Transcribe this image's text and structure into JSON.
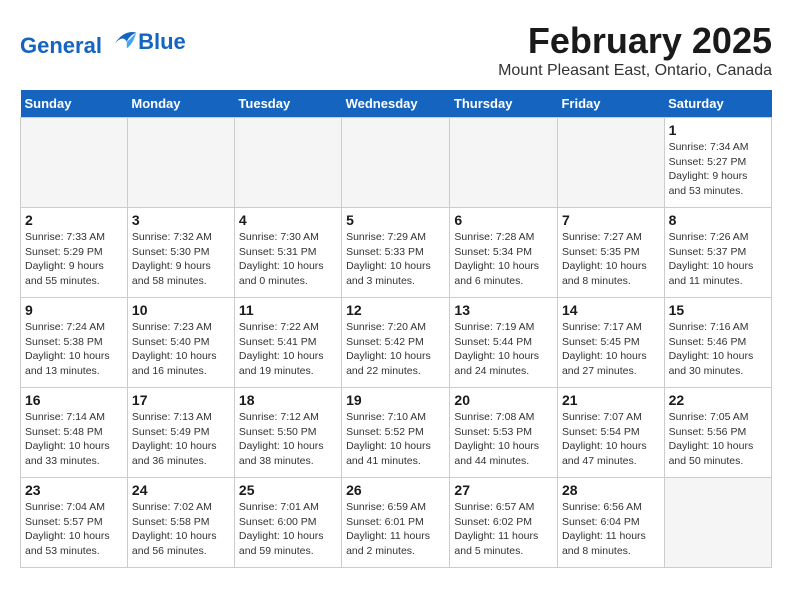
{
  "logo": {
    "line1": "General",
    "line2": "Blue"
  },
  "title": "February 2025",
  "subtitle": "Mount Pleasant East, Ontario, Canada",
  "days_of_week": [
    "Sunday",
    "Monday",
    "Tuesday",
    "Wednesday",
    "Thursday",
    "Friday",
    "Saturday"
  ],
  "weeks": [
    [
      {
        "day": "",
        "info": ""
      },
      {
        "day": "",
        "info": ""
      },
      {
        "day": "",
        "info": ""
      },
      {
        "day": "",
        "info": ""
      },
      {
        "day": "",
        "info": ""
      },
      {
        "day": "",
        "info": ""
      },
      {
        "day": "1",
        "info": "Sunrise: 7:34 AM\nSunset: 5:27 PM\nDaylight: 9 hours and 53 minutes."
      }
    ],
    [
      {
        "day": "2",
        "info": "Sunrise: 7:33 AM\nSunset: 5:29 PM\nDaylight: 9 hours and 55 minutes."
      },
      {
        "day": "3",
        "info": "Sunrise: 7:32 AM\nSunset: 5:30 PM\nDaylight: 9 hours and 58 minutes."
      },
      {
        "day": "4",
        "info": "Sunrise: 7:30 AM\nSunset: 5:31 PM\nDaylight: 10 hours and 0 minutes."
      },
      {
        "day": "5",
        "info": "Sunrise: 7:29 AM\nSunset: 5:33 PM\nDaylight: 10 hours and 3 minutes."
      },
      {
        "day": "6",
        "info": "Sunrise: 7:28 AM\nSunset: 5:34 PM\nDaylight: 10 hours and 6 minutes."
      },
      {
        "day": "7",
        "info": "Sunrise: 7:27 AM\nSunset: 5:35 PM\nDaylight: 10 hours and 8 minutes."
      },
      {
        "day": "8",
        "info": "Sunrise: 7:26 AM\nSunset: 5:37 PM\nDaylight: 10 hours and 11 minutes."
      }
    ],
    [
      {
        "day": "9",
        "info": "Sunrise: 7:24 AM\nSunset: 5:38 PM\nDaylight: 10 hours and 13 minutes."
      },
      {
        "day": "10",
        "info": "Sunrise: 7:23 AM\nSunset: 5:40 PM\nDaylight: 10 hours and 16 minutes."
      },
      {
        "day": "11",
        "info": "Sunrise: 7:22 AM\nSunset: 5:41 PM\nDaylight: 10 hours and 19 minutes."
      },
      {
        "day": "12",
        "info": "Sunrise: 7:20 AM\nSunset: 5:42 PM\nDaylight: 10 hours and 22 minutes."
      },
      {
        "day": "13",
        "info": "Sunrise: 7:19 AM\nSunset: 5:44 PM\nDaylight: 10 hours and 24 minutes."
      },
      {
        "day": "14",
        "info": "Sunrise: 7:17 AM\nSunset: 5:45 PM\nDaylight: 10 hours and 27 minutes."
      },
      {
        "day": "15",
        "info": "Sunrise: 7:16 AM\nSunset: 5:46 PM\nDaylight: 10 hours and 30 minutes."
      }
    ],
    [
      {
        "day": "16",
        "info": "Sunrise: 7:14 AM\nSunset: 5:48 PM\nDaylight: 10 hours and 33 minutes."
      },
      {
        "day": "17",
        "info": "Sunrise: 7:13 AM\nSunset: 5:49 PM\nDaylight: 10 hours and 36 minutes."
      },
      {
        "day": "18",
        "info": "Sunrise: 7:12 AM\nSunset: 5:50 PM\nDaylight: 10 hours and 38 minutes."
      },
      {
        "day": "19",
        "info": "Sunrise: 7:10 AM\nSunset: 5:52 PM\nDaylight: 10 hours and 41 minutes."
      },
      {
        "day": "20",
        "info": "Sunrise: 7:08 AM\nSunset: 5:53 PM\nDaylight: 10 hours and 44 minutes."
      },
      {
        "day": "21",
        "info": "Sunrise: 7:07 AM\nSunset: 5:54 PM\nDaylight: 10 hours and 47 minutes."
      },
      {
        "day": "22",
        "info": "Sunrise: 7:05 AM\nSunset: 5:56 PM\nDaylight: 10 hours and 50 minutes."
      }
    ],
    [
      {
        "day": "23",
        "info": "Sunrise: 7:04 AM\nSunset: 5:57 PM\nDaylight: 10 hours and 53 minutes."
      },
      {
        "day": "24",
        "info": "Sunrise: 7:02 AM\nSunset: 5:58 PM\nDaylight: 10 hours and 56 minutes."
      },
      {
        "day": "25",
        "info": "Sunrise: 7:01 AM\nSunset: 6:00 PM\nDaylight: 10 hours and 59 minutes."
      },
      {
        "day": "26",
        "info": "Sunrise: 6:59 AM\nSunset: 6:01 PM\nDaylight: 11 hours and 2 minutes."
      },
      {
        "day": "27",
        "info": "Sunrise: 6:57 AM\nSunset: 6:02 PM\nDaylight: 11 hours and 5 minutes."
      },
      {
        "day": "28",
        "info": "Sunrise: 6:56 AM\nSunset: 6:04 PM\nDaylight: 11 hours and 8 minutes."
      },
      {
        "day": "",
        "info": ""
      }
    ]
  ]
}
